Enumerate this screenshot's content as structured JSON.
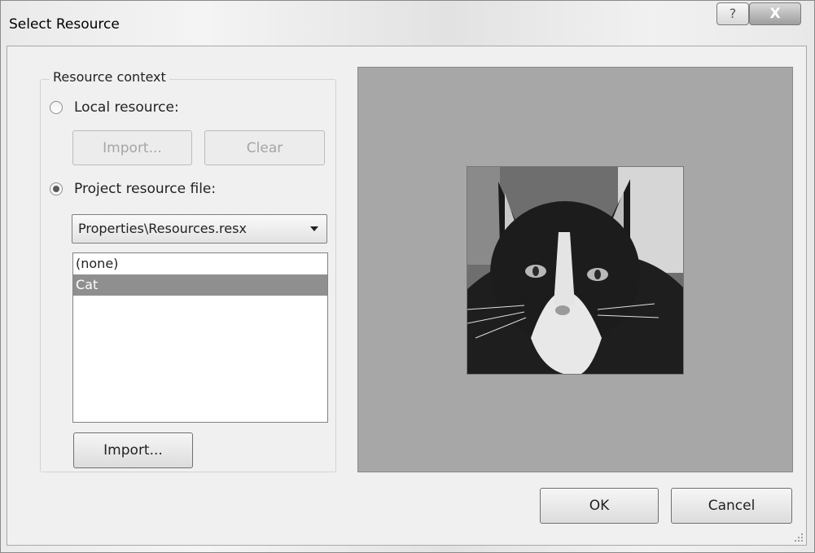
{
  "window": {
    "title": "Select Resource",
    "help_glyph": "?",
    "close_glyph": "X"
  },
  "resource_context": {
    "group_label": "Resource context",
    "local_resource_label": "Local resource:",
    "local_resource_checked": false,
    "local_import_label": "Import...",
    "local_clear_label": "Clear",
    "project_resource_label": "Project resource file:",
    "project_resource_checked": true,
    "project_file_selected": "Properties\\Resources.resx",
    "resources": [
      "(none)",
      "Cat"
    ],
    "selected_resource": "Cat",
    "project_import_label": "Import..."
  },
  "preview": {
    "image": "cat-photo"
  },
  "footer": {
    "ok_label": "OK",
    "cancel_label": "Cancel"
  },
  "icons": [
    "help-icon",
    "close-icon",
    "dropdown-arrow-icon",
    "resize-grip-icon"
  ]
}
